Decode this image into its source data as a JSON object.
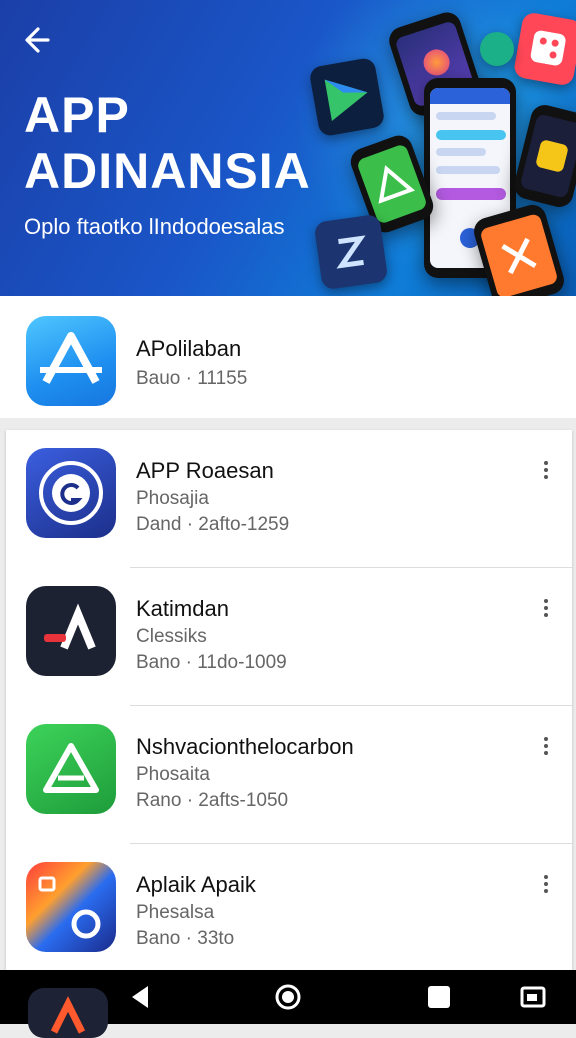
{
  "header": {
    "title_line1": "APP",
    "title_line2": "ADINANSIA",
    "subtitle": "Oplo ftaotko lIndodoesalas",
    "back_icon": "back-arrow-icon"
  },
  "featured": {
    "name": "APolilaban",
    "meta": "Bauo · 11155",
    "icon": "app-store-a-icon",
    "color": "#1e8ff0"
  },
  "apps": [
    {
      "name": "APP Roaesan",
      "category": "Phosajia",
      "meta": "Dand · 2afto-1259",
      "icon": "circle-g-icon",
      "color": "#2340a8"
    },
    {
      "name": "Katimdan",
      "category": "Clessiks",
      "meta": "Bano · 11do-1009",
      "icon": "a-logo-icon",
      "color": "#1d2233"
    },
    {
      "name": "Nshvacionthelocarbon",
      "category": "Phosaita",
      "meta": "Rano · 2afts-1050",
      "icon": "triangle-a-icon",
      "color": "#2fb34a"
    },
    {
      "name": "Aplaik Apaik",
      "category": "Phesalsa",
      "meta": "Bano · 33to",
      "icon": "gradient-c-icon",
      "color": "#e8452e"
    }
  ],
  "navbar": {
    "back_icon": "nav-back-icon",
    "home_icon": "nav-home-icon",
    "recents_icon": "nav-recents-icon",
    "screenshot_icon": "nav-screenshot-icon"
  }
}
